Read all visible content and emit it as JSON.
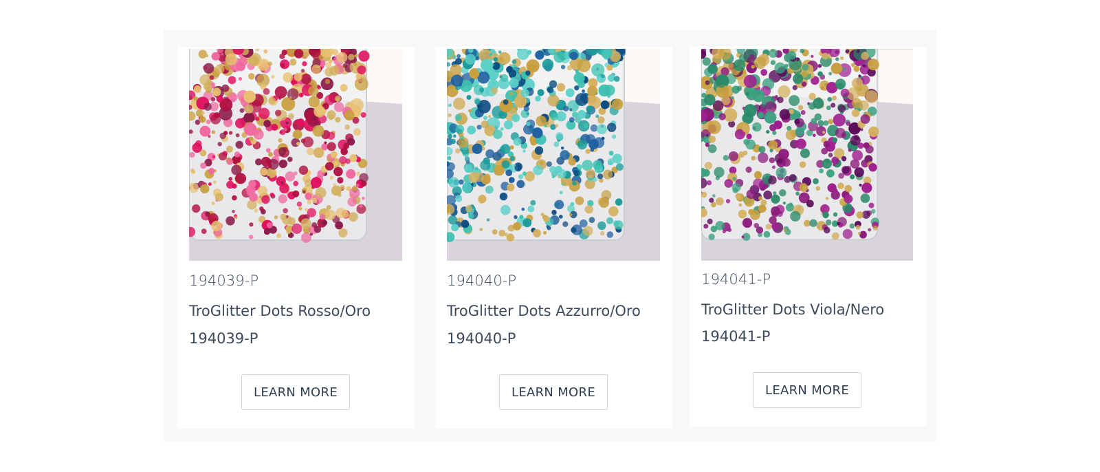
{
  "products": [
    {
      "sku": "194039-P",
      "name": "TroGlitter Dots Rosso/Oro",
      "sku_repeat": "194039-P",
      "button_label": "LEARN MORE",
      "image_icon": "product-photo-glitter-red-gold",
      "palette": [
        "#e0115f",
        "#c8a040",
        "#8b1a4a",
        "#f06aa0",
        "#d4b060",
        "#b01040",
        "#e8c070"
      ]
    },
    {
      "sku": "194040-P",
      "name": "TroGlitter Dots Azzurro/Oro",
      "sku_repeat": "194040-P",
      "button_label": "LEARN MORE",
      "image_icon": "product-photo-glitter-blue-gold",
      "palette": [
        "#1a9a9a",
        "#c8a040",
        "#1e5fa0",
        "#3cc0b0",
        "#d4b060",
        "#0a4a80",
        "#5ad0c8"
      ]
    },
    {
      "sku": "194041-P",
      "name": "TroGlitter Dots Viola/Nero",
      "sku_repeat": "194041-P",
      "button_label": "LEARN MORE",
      "image_icon": "product-photo-glitter-purple-black",
      "palette": [
        "#8a1a7a",
        "#c8a040",
        "#2a8a6a",
        "#5a0a5a",
        "#d4b060",
        "#3aa080",
        "#a02090"
      ]
    }
  ]
}
